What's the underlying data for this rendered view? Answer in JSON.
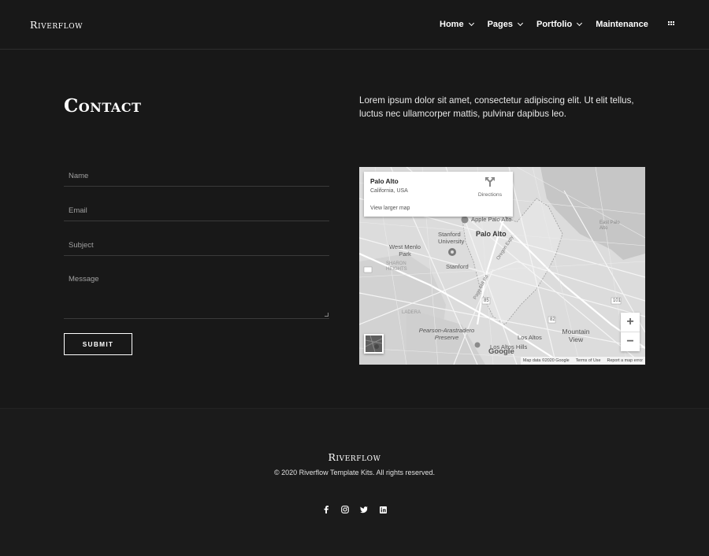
{
  "header": {
    "brand": "Riverflow",
    "nav": [
      {
        "label": "Home",
        "has_dropdown": true
      },
      {
        "label": "Pages",
        "has_dropdown": true
      },
      {
        "label": "Portfolio",
        "has_dropdown": true
      },
      {
        "label": "Maintenance",
        "has_dropdown": false
      }
    ],
    "menu_icon": "grid-icon"
  },
  "main": {
    "title": "Contact",
    "intro": "Lorem ipsum dolor sit amet, consectetur adipiscing elit. Ut elit tellus, luctus nec ullamcorper mattis, pulvinar dapibus leo.",
    "form": {
      "name_placeholder": "Name",
      "email_placeholder": "Email",
      "subject_placeholder": "Subject",
      "message_placeholder": "Message",
      "submit_label": "SUBMIT"
    }
  },
  "map": {
    "info_title": "Palo Alto",
    "info_subtitle": "California, USA",
    "directions_label": "Directions",
    "larger_map_link": "View larger map",
    "zoom_in": "+",
    "zoom_out": "−",
    "labels": {
      "palo_alto": "Palo Alto",
      "stanford_university": "Stanford University",
      "west_menlo_park": "West Menlo Park",
      "sharon_heights": "SHARON HEIGHTS",
      "stanford": "Stanford",
      "apple_store": "Apple Palo Alto",
      "ladera": "LADERA",
      "pearson_preserve": "Pearson-Arastradero Preserve",
      "los_altos_hills": "Los Altos Hills",
      "los_altos": "Los Altos",
      "mountain_view": "Mountain View",
      "east_palo_alto": "East Palo Alto",
      "page_mill_rd": "Page Mill Rd",
      "oregon_expy": "Oregon Expy",
      "hwy_101": "101",
      "hwy_82": "82",
      "hwy_85": "85",
      "google": "Google"
    },
    "attribution": {
      "map_data": "Map data ©2020 Google",
      "terms": "Terms of Use",
      "report": "Report a map error"
    }
  },
  "footer": {
    "brand": "Riverflow",
    "copyright": "© 2020 Riverflow Template Kits. All rights reserved.",
    "socials": [
      "facebook-icon",
      "instagram-icon",
      "twitter-icon",
      "linkedin-icon"
    ]
  }
}
